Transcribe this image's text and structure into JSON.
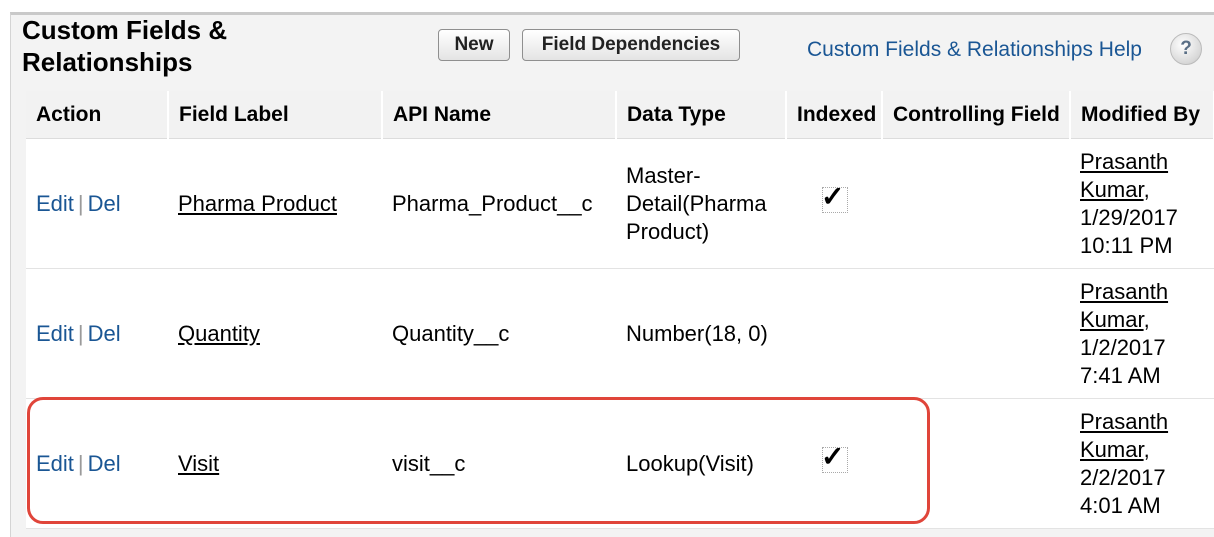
{
  "header": {
    "title": "Custom Fields & Relationships",
    "new_button": "New",
    "field_dependencies_button": "Field Dependencies",
    "help_link": "Custom Fields & Relationships Help",
    "help_icon": "?"
  },
  "table": {
    "columns": [
      "Action",
      "Field Label",
      "API Name",
      "Data Type",
      "Indexed",
      "Controlling Field",
      "Modified By"
    ],
    "rows": [
      {
        "edit": "Edit",
        "sep": "|",
        "del": "Del",
        "field_label": "Pharma Product",
        "api_name": "Pharma_Product__c",
        "data_type": "Master-Detail(Pharma Product)",
        "indexed": true,
        "controlling_field": "",
        "modified_user": "Prasanth Kumar",
        "modified_date": ", 1/29/2017 10:11 PM"
      },
      {
        "edit": "Edit",
        "sep": "|",
        "del": "Del",
        "field_label": "Quantity",
        "api_name": "Quantity__c",
        "data_type": "Number(18, 0)",
        "indexed": false,
        "controlling_field": "",
        "modified_user": "Prasanth Kumar",
        "modified_date": ", 1/2/2017 7:41 AM"
      },
      {
        "edit": "Edit",
        "sep": "|",
        "del": "Del",
        "field_label": "Visit",
        "api_name": "visit__c",
        "data_type": "Lookup(Visit)",
        "indexed": true,
        "controlling_field": "",
        "modified_user": "Prasanth Kumar",
        "modified_date": ", 2/2/2017 4:01 AM"
      }
    ]
  },
  "checkmark_glyph": "✓",
  "colors": {
    "link": "#1a5694",
    "highlight": "#e0453a"
  }
}
